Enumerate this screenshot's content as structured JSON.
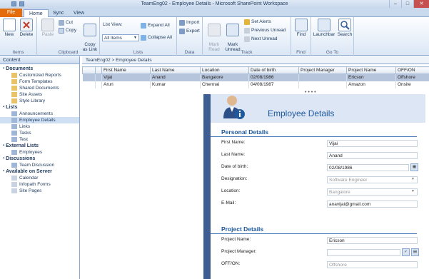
{
  "window": {
    "title": "TeamEng02 - Employee Details - Microsoft SharePoint Workspace",
    "min": "–",
    "max": "□",
    "close": "✕"
  },
  "tabs": {
    "file": "File",
    "home": "Home",
    "sync": "Sync",
    "view": "View"
  },
  "ribbon": {
    "items": {
      "new": "New",
      "delete": "Delete",
      "label": "Items"
    },
    "clipboard": {
      "paste": "Paste",
      "cut": "Cut",
      "copy": "Copy",
      "copy_as_link": "Copy\nas Link",
      "label": "Clipboard"
    },
    "lists": {
      "list_view": "List View:",
      "all_items": "All Items",
      "expand_all": "Expand All",
      "collapse_all": "Collapse All",
      "label": "Lists"
    },
    "data": {
      "import": "Import",
      "export": "Export",
      "label": "Data"
    },
    "track": {
      "mark_read": "Mark\nRead",
      "mark_unread": "Mark\nUnread",
      "set_alerts": "Set Alerts",
      "previous_unread": "Previous Unread",
      "next_unread": "Next Unread",
      "label": "Track"
    },
    "find": {
      "find": "Find",
      "label": "Find"
    },
    "goto": {
      "launchbar": "Launchbar",
      "search": "Search",
      "label": "Go To"
    }
  },
  "left_pane": {
    "header": "Content",
    "sections": [
      {
        "title": "Documents",
        "items": [
          "Customized Reports",
          "Form Templates",
          "Shared Documents",
          "Site Assets",
          "Style Library"
        ]
      },
      {
        "title": "Lists",
        "items": [
          "Announcements",
          "Employee Details",
          "Links",
          "Tasks",
          "Test"
        ]
      },
      {
        "title": "External Lists",
        "items": [
          "Employees"
        ]
      },
      {
        "title": "Discussions",
        "items": [
          "Team Discussion"
        ]
      },
      {
        "title": "Available on Server",
        "items": [
          "Calendar",
          "Infopath Forms",
          "Site Pages"
        ]
      }
    ]
  },
  "breadcrumb": "TeamEng02 > Employee Details",
  "grid": {
    "columns": [
      "First Name",
      "Last Name",
      "Location",
      "Date of birth",
      "Project Manager",
      "Project Name",
      "OFF/ON"
    ],
    "rows": [
      [
        "Vijai",
        "Anand",
        "Bangalore",
        "02/08/1986",
        "",
        "Ericson",
        "Offshore"
      ],
      [
        "Arun",
        "Kumar",
        "Chennai",
        "04/08/1987",
        "",
        "Amazon",
        "Onsite"
      ]
    ]
  },
  "form": {
    "title": "Employee Details",
    "personal": {
      "heading": "Personal Details",
      "first_name_label": "First Name:",
      "first_name": "Vijai",
      "last_name_label": "Last Name:",
      "last_name": "Anand",
      "dob_label": "Date of birth:",
      "dob": "02/08/1986",
      "designation_label": "Designation:",
      "designation": "Software Engineer",
      "location_label": "Location:",
      "location": "Bangalore",
      "email_label": "E-Mail:",
      "email": "anavijai@gmail.com"
    },
    "project": {
      "heading": "Project Details",
      "project_name_label": "Project Name:",
      "project_name": "Ericson",
      "project_manager_label": "Project Manager:",
      "project_manager": "",
      "offon_label": "OFF/ON:",
      "offon": "Offshore"
    }
  }
}
